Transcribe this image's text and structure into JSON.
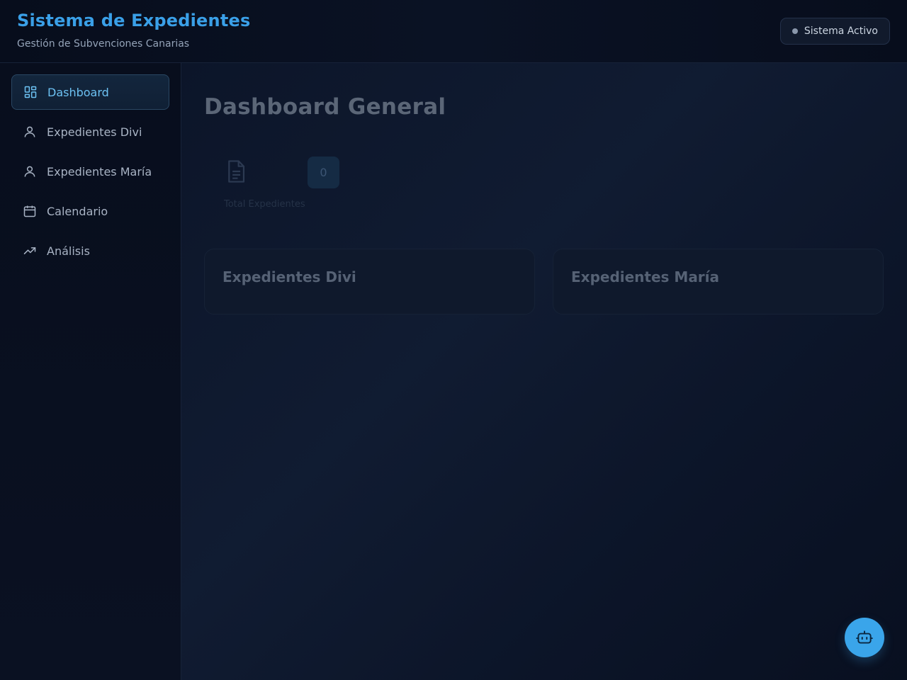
{
  "header": {
    "title": "Sistema de Expedientes",
    "subtitle": "Gestión de Subvenciones Canarias",
    "status_label": "Sistema Activo"
  },
  "sidebar": {
    "items": [
      {
        "label": "Dashboard",
        "icon": "dashboard-icon",
        "active": true
      },
      {
        "label": "Expedientes Divi",
        "icon": "user-icon",
        "active": false
      },
      {
        "label": "Expedientes María",
        "icon": "user-icon",
        "active": false
      },
      {
        "label": "Calendario",
        "icon": "calendar-icon",
        "active": false
      },
      {
        "label": "Análisis",
        "icon": "trending-up-icon",
        "active": false
      }
    ]
  },
  "main": {
    "page_title": "Dashboard General",
    "stat": {
      "label": "Total Expedientes",
      "value": "0",
      "icon": "document-icon"
    },
    "sections": [
      {
        "title": "Expedientes Divi"
      },
      {
        "title": "Expedientes María"
      }
    ]
  },
  "fab": {
    "icon": "bot-icon"
  },
  "colors": {
    "accent": "#3aa0e8",
    "active_nav_text": "#6cc1f2",
    "background": "#0a1122"
  }
}
